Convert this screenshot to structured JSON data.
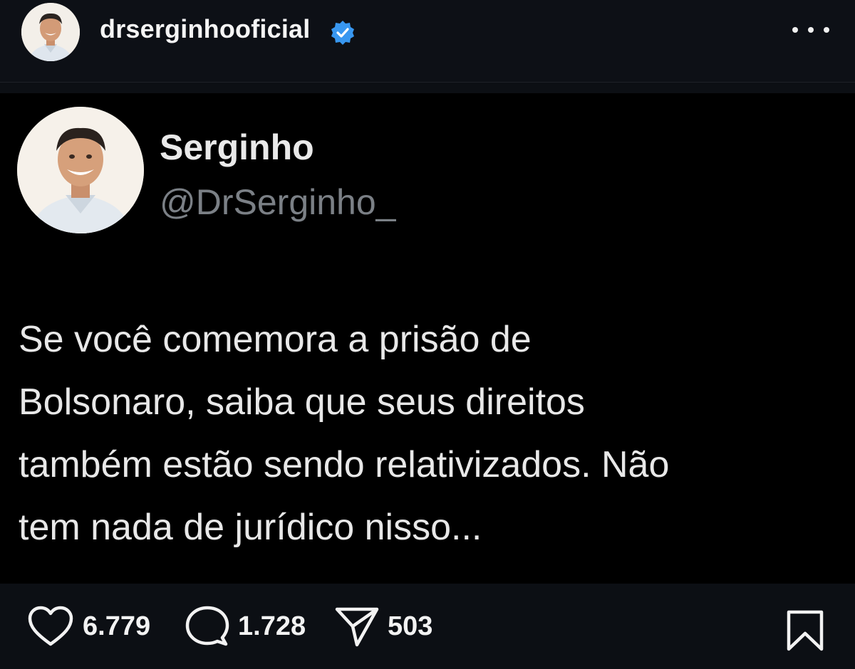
{
  "header": {
    "username": "drserginhooficial",
    "verified_icon": "verified-badge-icon",
    "more_icon": "more-options-icon",
    "avatar_icon": "profile-avatar"
  },
  "tweet": {
    "display_name": "Serginho",
    "handle": "@DrSerginho_",
    "text_lines": [
      "Se você comemora a prisão de",
      "Bolsonaro, saiba que seus direitos",
      "também estão sendo relativizados. Não",
      "tem nada de jurídico nisso..."
    ]
  },
  "actions": {
    "likes": "6.779",
    "comments": "1.728",
    "shares": "503",
    "icons": [
      "heart-icon",
      "comment-icon",
      "send-icon",
      "bookmark-icon"
    ]
  },
  "colors": {
    "verified": "#3897f0",
    "background": "#0c0f14",
    "card": "#000000",
    "handle": "#7b8086"
  }
}
